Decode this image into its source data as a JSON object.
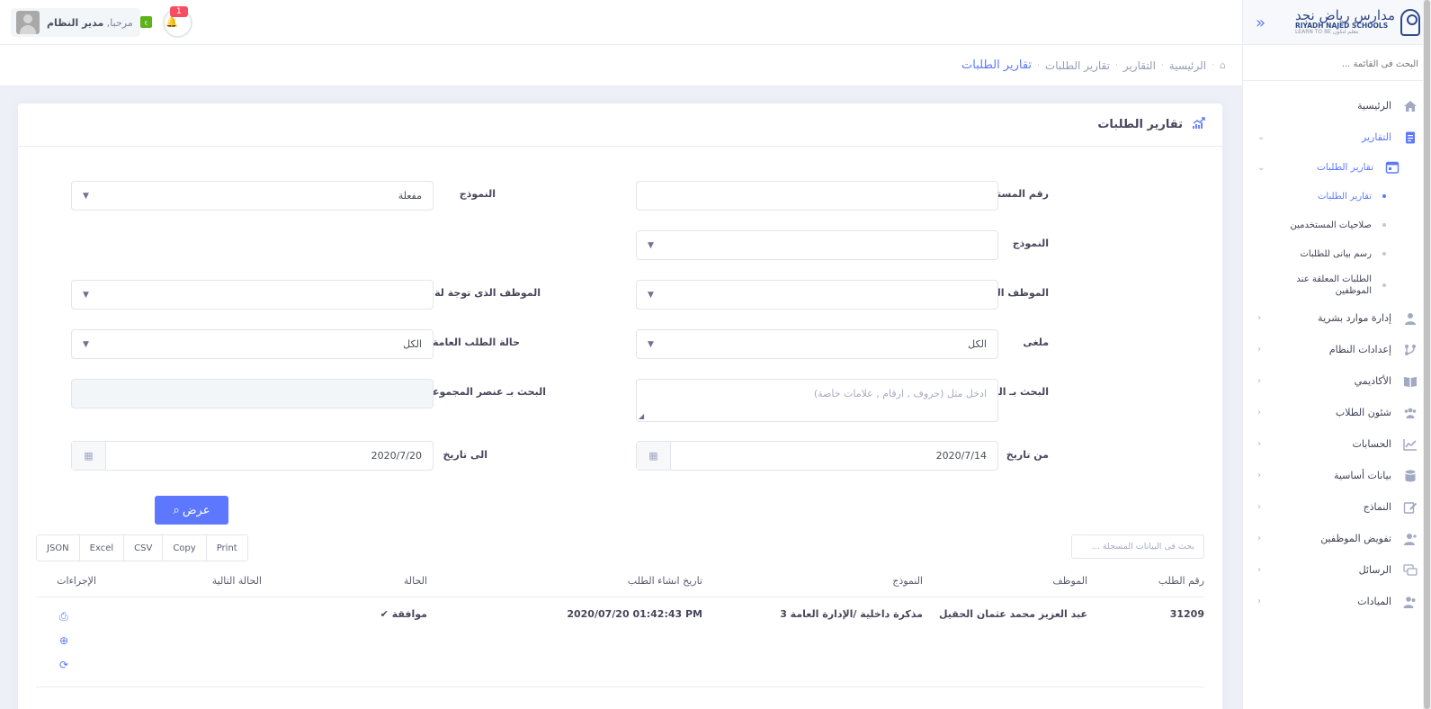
{
  "brand": {
    "name_ar": "مدارس رياض نجد",
    "name_en": "RIYADH NAJED SCHOOLS",
    "tagline": "LEARN TO BE   نتعلم لنكون"
  },
  "sidebar": {
    "search_placeholder": "البحث فى القائمة ...",
    "items": [
      {
        "label": "الرئيسية",
        "icon": "home-icon"
      },
      {
        "label": "التقارير",
        "icon": "report-icon",
        "expanded": true
      },
      {
        "label": "تقارير الطلبات",
        "icon": "calendar-report-icon",
        "expanded": true
      },
      {
        "label": "تقارير الطلبات"
      },
      {
        "label": "صلاحيات المستخدمين"
      },
      {
        "label": "رسم بيانى للطلبات"
      },
      {
        "label": "الطلبات المعلقة عند الموظفين"
      },
      {
        "label": "إدارة موارد بشرية",
        "icon": "user-icon"
      },
      {
        "label": "إعدادات النظام",
        "icon": "settings-icon"
      },
      {
        "label": "الأكاديمي",
        "icon": "book-icon"
      },
      {
        "label": "شئون الطلاب",
        "icon": "group-icon"
      },
      {
        "label": "الحسابات",
        "icon": "chart-line-icon"
      },
      {
        "label": "بيانات أساسية",
        "icon": "database-icon"
      },
      {
        "label": "النماذج",
        "icon": "form-icon"
      },
      {
        "label": "تفويض الموظفين",
        "icon": "user-add-icon"
      },
      {
        "label": "الرسائل",
        "icon": "messages-icon"
      },
      {
        "label": "الميادات",
        "icon": "users-icon"
      }
    ]
  },
  "topbar": {
    "greeting": "مرحبا,",
    "user_name": "مدير النظام",
    "notification_count": "1"
  },
  "breadcrumb": [
    "الرئيسية",
    "التقارير",
    "تقارير الطلبات",
    "تقارير الطلبات"
  ],
  "card": {
    "title": "تقارير الطلبات"
  },
  "form": {
    "doc_number_label": "رقم المستند",
    "doc_number_value": "",
    "form_label_1": "النموذج",
    "form_value_1": "مفعلة",
    "form_label_2": "النموذج",
    "form_value_2": "",
    "creator_label": "الموظف الذى انشاه",
    "creator_value": "",
    "assignee_label": "الموظف الذى توجة لة",
    "assignee_value": "",
    "cancelled_label": "ملغى",
    "cancelled_value": "الكل",
    "status_label": "حالة الطلب العامة",
    "status_value": "الكل",
    "text_search_label": "البحث بـ النص",
    "text_search_placeholder": "ادخل مثل (حروف , ارقام , علامات خاصة)",
    "group_search_label": "البحث بـ عنصر المجموعة",
    "from_date_label": "من تاريخ",
    "from_date_value": "2020/7/14",
    "to_date_label": "الى تاريخ",
    "to_date_value": "2020/7/20",
    "show_button": "عرض"
  },
  "table": {
    "search_placeholder": "بحث فى البيانات المسجلة ...",
    "exports": [
      "JSON",
      "Excel",
      "CSV",
      "Copy",
      "Print"
    ],
    "columns": [
      "رقم الطلب",
      "الموظف",
      "النموذج",
      "تاريخ انشاء الطلب",
      "الحالة",
      "الحالة التالية",
      "الإجراءات"
    ],
    "rows": [
      {
        "id": "31209",
        "employee": "عبد العزيز محمد عثمان الحقيل",
        "form": "مذكرة داخلية /الإدارة العامة 3",
        "created": "2020/07/20 01:42:43 PM",
        "status": "موافقة",
        "next_status": ""
      }
    ]
  }
}
